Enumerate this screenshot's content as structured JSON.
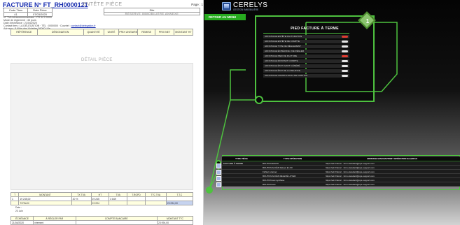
{
  "invoice": {
    "title": "FACTURE N° FT_RH0000121",
    "section": "ENTÊTE PIÈCE",
    "page": "Page : 1",
    "code_headers": [
      "Code Tiers",
      "Date Pièce"
    ],
    "code_values": [
      "41",
      "07/03/2020"
    ],
    "site": {
      "label": "Site",
      "value": "RÉSERVE IMMOBILIÈRE ANNEXE"
    },
    "info_lines": [
      "N° TVA intracommunautaire : FR 44 0 0000",
      "Mode de règlement : 45 jours",
      "Date d'échéance : 21/04/2020",
      "Contact tiers : LA DÉLÉGATION · TÉL : 0000000 · Courriel :",
      "Adresse : 8 Allée des Violettes 59000 Lille"
    ],
    "contact_link": "contact@delegation.fr",
    "item_columns": [
      "RÉFÉRENCE",
      "DÉSIGNATION",
      "QUANTITÉ",
      "UNITÉ",
      "PRIX UNITAIRE",
      "REMISE",
      "PRIX NET",
      "MONTANT HT"
    ],
    "detail_label": "DÉTAIL PIÈCE",
    "totals": {
      "headers": [
        "T",
        "MONTANT",
        "TX TVA",
        "HT",
        "TVA",
        "T.RGPD",
        "TTC TVA",
        "T.T.C"
      ],
      "rows": [
        [
          "1",
          "19 245,00",
          "20 %",
          "19 245",
          "3 849",
          "",
          "",
          ""
        ],
        [
          "",
          "TOTAUX",
          "",
          "23 094",
          "",
          "",
          "",
          "23 094,00"
        ]
      ]
    },
    "misc": [
      "Date :",
      "23 Juin"
    ],
    "reglement": {
      "headers": [
        "ÉCHÉANCE",
        "À RÉGLER PAR",
        "COMPTE BANCAIRE",
        "MONTANT TTC"
      ],
      "row": [
        "21/04/2020",
        "virement",
        "",
        "23 094,00"
      ]
    }
  },
  "app": {
    "brand_name": "CERELYS",
    "brand_sub": "GESTION IMMOBILIÈRE",
    "back_label": "RETOUR AU MENU",
    "workflow": {
      "title": "PIED FACTURE À TERME",
      "badge": "1",
      "steps": [
        {
          "label": "AFFICHAGE ENTÊTE FACTURATION",
          "status": "#e03c31"
        },
        {
          "label": "AFFICHAGE ENTÊTE DE COMPTE",
          "status": "#e5e5e5"
        },
        {
          "label": "AFFICHAGE TYPE DE RÈGLEMENT",
          "status": "#e5e5e5"
        },
        {
          "label": "AFFICHAGE ÉCHÉANCE / DE RÉGLER",
          "status": "#e5e5e5"
        },
        {
          "label": "AFFICHAGE PIED DE FACTURE",
          "status": "#e03c31"
        },
        {
          "label": "AFFICHAGE MONTANT COMPTE",
          "status": "#e5e5e5"
        },
        {
          "label": "AFFICHAGE ÉTAT AVANT GÉNÉRÉ",
          "status": "#e5e5e5"
        },
        {
          "label": "AFFICHAGE ÉTAT DE LA RELANCE",
          "status": "#e5e5e5"
        },
        {
          "label": "AFFICHAGE COMPTE FINAL DE GESTION",
          "status": "#e5e5e5"
        }
      ]
    },
    "operations": {
      "columns": [
        "TYPE PIÈCE",
        "TYPE OPÉRATION",
        "ADRESSE ENVOI/APPORT OPÉRATION Email/FAX"
      ],
      "rows": [
        [
          "FACTURE À TERME",
          "BOUTON ENVOI",
          "https://ad.fr/docs/ · form-standard@ops-support.com"
        ],
        [
          "",
          "BOUTON ACCÈS Relevé En 60",
          "https://ad.fr/docs/ · form-standard@ops-support.com"
        ],
        [
          "",
          "Fichier à lancer",
          "https://ad.fr/docs/ · form-standard@ops-support.com"
        ],
        [
          "",
          "BOUTON ACCÈS RELEVÉ LOYER",
          "https://ad.fr/docs/ · form-standard@ops-support.com"
        ],
        [
          "",
          "BOUTON test synthèse",
          "https://ad.fr/docs/ · form-standard@ops-support.com"
        ],
        [
          "",
          "BOUTON test",
          "https://ad.fr/docs/ · form-standard@ops-support.com"
        ]
      ]
    }
  },
  "colors": {
    "accent": "#4ec23f",
    "link": "#1a2fb0",
    "status_red": "#e03c31"
  }
}
